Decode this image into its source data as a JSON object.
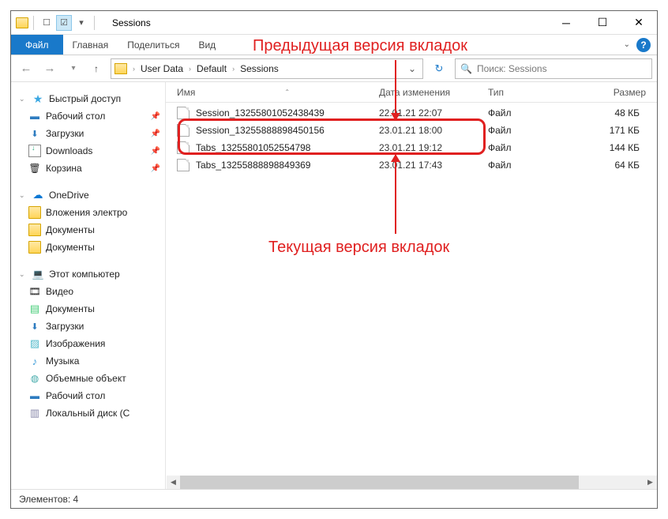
{
  "title": "Sessions",
  "ribbon": {
    "file": "Файл",
    "home": "Главная",
    "share": "Поделиться",
    "view": "Вид"
  },
  "breadcrumb": [
    "User Data",
    "Default",
    "Sessions"
  ],
  "search_placeholder": "Поиск: Sessions",
  "columns": {
    "name": "Имя",
    "date": "Дата изменения",
    "type": "Тип",
    "size": "Размер"
  },
  "files": [
    {
      "name": "Session_13255801052438439",
      "date": "22.01.21 22:07",
      "type": "Файл",
      "size": "48 КБ"
    },
    {
      "name": "Session_13255888898450156",
      "date": "23.01.21 18:00",
      "type": "Файл",
      "size": "171 КБ"
    },
    {
      "name": "Tabs_13255801052554798",
      "date": "23.01.21 19:12",
      "type": "Файл",
      "size": "144 КБ"
    },
    {
      "name": "Tabs_13255888898849369",
      "date": "23.01.21 17:43",
      "type": "Файл",
      "size": "64 КБ"
    }
  ],
  "sidebar": {
    "quick": "Быстрый доступ",
    "desktop": "Рабочий стол",
    "downloads": "Загрузки",
    "downloads2": "Downloads",
    "trash": "Корзина",
    "onedrive": "OneDrive",
    "attach": "Вложения электро",
    "docs": "Документы",
    "docs2": "Документы",
    "thispc": "Этот компьютер",
    "video": "Видео",
    "downloads3": "Загрузки",
    "images": "Изображения",
    "music": "Музыка",
    "objects3d": "Объемные объект",
    "desktop2": "Рабочий стол",
    "diskC": "Локальный диск (C"
  },
  "status": {
    "label": "Элементов:",
    "count": "4"
  },
  "annot": {
    "prev": "Предыдущая версия вкладок",
    "cur": "Текущая версия вкладок"
  }
}
